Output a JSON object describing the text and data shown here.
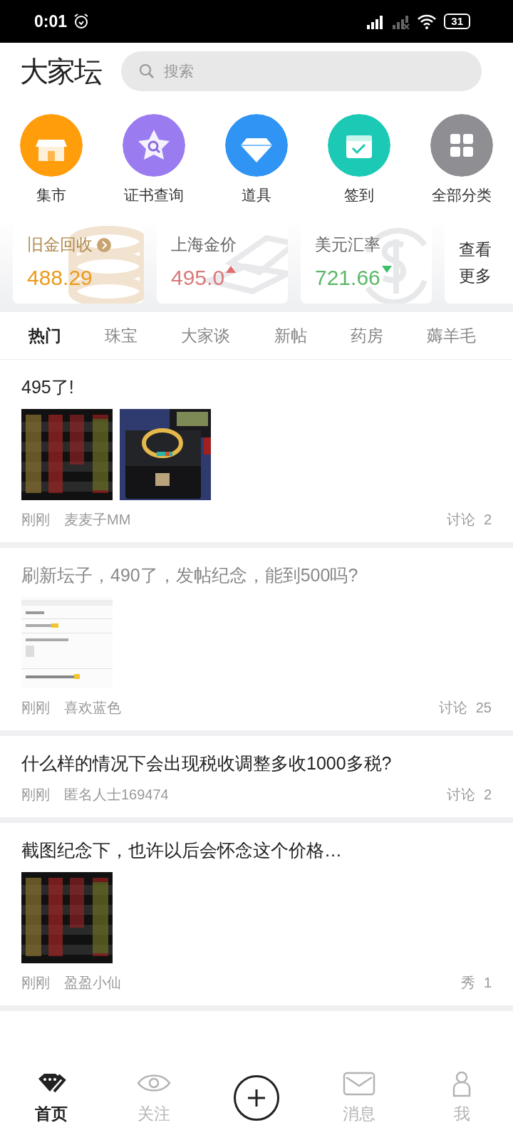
{
  "status_bar": {
    "time": "0:01",
    "battery": "31"
  },
  "header": {
    "logo": "大家坛",
    "search": {
      "placeholder": "搜索"
    }
  },
  "shortcuts": [
    {
      "label": "集市",
      "kind": "market",
      "color": "#ff9d0a"
    },
    {
      "label": "证书查询",
      "kind": "certificate",
      "color": "#9a7cf0"
    },
    {
      "label": "道具",
      "kind": "diamond",
      "color": "#2f94f3"
    },
    {
      "label": "签到",
      "kind": "calendar",
      "color": "#1bc9b5"
    },
    {
      "label": "全部分类",
      "kind": "grid",
      "color": "#8e8e93"
    }
  ],
  "price_cards": [
    {
      "title": "旧金回收",
      "value": "488.29",
      "link": true,
      "kind": "coins",
      "color": "#ec9b1c"
    },
    {
      "title": "上海金价",
      "value": "495.0",
      "up": true,
      "link": false,
      "kind": "bars",
      "color": "#d9797b"
    },
    {
      "title": "美元汇率",
      "value": "721.66",
      "up": false,
      "link": false,
      "kind": "dollar",
      "color": "#5cb867"
    }
  ],
  "more_card": {
    "label": "查看更多"
  },
  "tabs": [
    {
      "label": "热门",
      "selected": true
    },
    {
      "label": "珠宝",
      "selected": false
    },
    {
      "label": "大家谈",
      "selected": false
    },
    {
      "label": "新帖",
      "selected": false
    },
    {
      "label": "药房",
      "selected": false
    },
    {
      "label": "薅羊毛",
      "selected": false
    }
  ],
  "posts": [
    {
      "title": "495了!",
      "read": false,
      "time": "刚刚",
      "author": "麦麦子MM",
      "stat_label": "讨论",
      "stat_count": "2"
    },
    {
      "title": "刷新坛子，490了，发帖纪念，能到500吗?",
      "read": true,
      "time": "刚刚",
      "author": "喜欢蓝色",
      "stat_label": "讨论",
      "stat_count": "25"
    },
    {
      "title": "什么样的情况下会出现税收调整多收1000多税?",
      "read": false,
      "time": "刚刚",
      "author": "匿名人士169474",
      "stat_label": "讨论",
      "stat_count": "2"
    },
    {
      "title": "截图纪念下，也许以后会怀念这个价格…",
      "read": false,
      "time": "刚刚",
      "author": "盈盈小仙",
      "stat_label": "秀",
      "stat_count": "1"
    }
  ],
  "bottom_nav": [
    {
      "label": "首页",
      "kind": "home",
      "selected": true
    },
    {
      "label": "关注",
      "kind": "eye",
      "selected": false
    },
    {
      "kind": "plus"
    },
    {
      "label": "消息",
      "kind": "mail",
      "selected": false
    },
    {
      "label": "我",
      "kind": "person",
      "selected": false
    }
  ]
}
